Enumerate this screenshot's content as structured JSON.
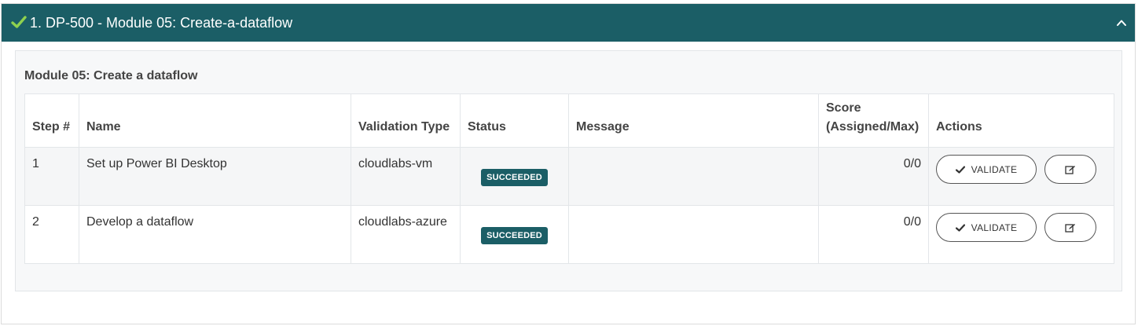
{
  "accordion": {
    "title": "1. DP-500 - Module 05: Create-a-dataflow",
    "header_color": "#1b5e66",
    "icons": {
      "status": "check-icon",
      "toggle": "chevron-up-icon"
    }
  },
  "module": {
    "title": "Module 05: Create a dataflow"
  },
  "table": {
    "headers": {
      "step": "Step #",
      "name": "Name",
      "validation_type": "Validation Type",
      "status": "Status",
      "message": "Message",
      "score_line1": "Score",
      "score_line2": "(Assigned/Max)",
      "actions": "Actions"
    },
    "rows": [
      {
        "step": "1",
        "name": "Set up Power BI Desktop",
        "validation_type": "cloudlabs-vm",
        "status": "SUCCEEDED",
        "message": "",
        "score": "0/0",
        "validate_label": "VALIDATE"
      },
      {
        "step": "2",
        "name": "Develop a dataflow",
        "validation_type": "cloudlabs-azure",
        "status": "SUCCEEDED",
        "message": "",
        "score": "0/0",
        "validate_label": "VALIDATE"
      }
    ]
  }
}
